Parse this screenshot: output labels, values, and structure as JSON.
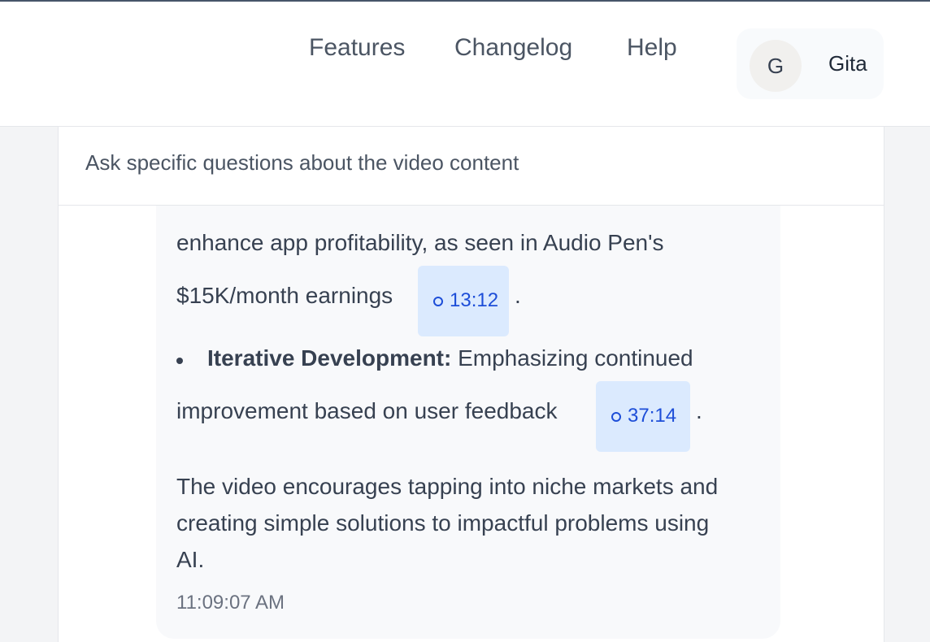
{
  "nav": {
    "links": [
      "Features",
      "Changelog",
      "Help"
    ]
  },
  "user": {
    "initial": "G",
    "name": "Gita"
  },
  "chat": {
    "subtitle": "Ask specific questions about the video content",
    "message": {
      "line1": "enhance app profitability, as seen in Audio Pen's",
      "line2": "$15K/month earnings",
      "timestamp1": "13:12",
      "bullet_title": "Iterative Development:",
      "bullet_text": " Emphasizing continued",
      "line4": "improvement based on user feedback",
      "timestamp2": "37:14",
      "period": ".",
      "conclusion_line1": "The video encourages tapping into niche markets and",
      "conclusion_line2": "creating simple solutions to impactful problems using",
      "conclusion_line3": "AI.",
      "time": "11:09:07 AM"
    }
  },
  "colors": {
    "accent": "#1d4ed8",
    "chip_bg": "#dbeafe",
    "bubble_bg": "#f8f9fb"
  },
  "icons": {
    "timestamp": "play-dot-icon"
  }
}
